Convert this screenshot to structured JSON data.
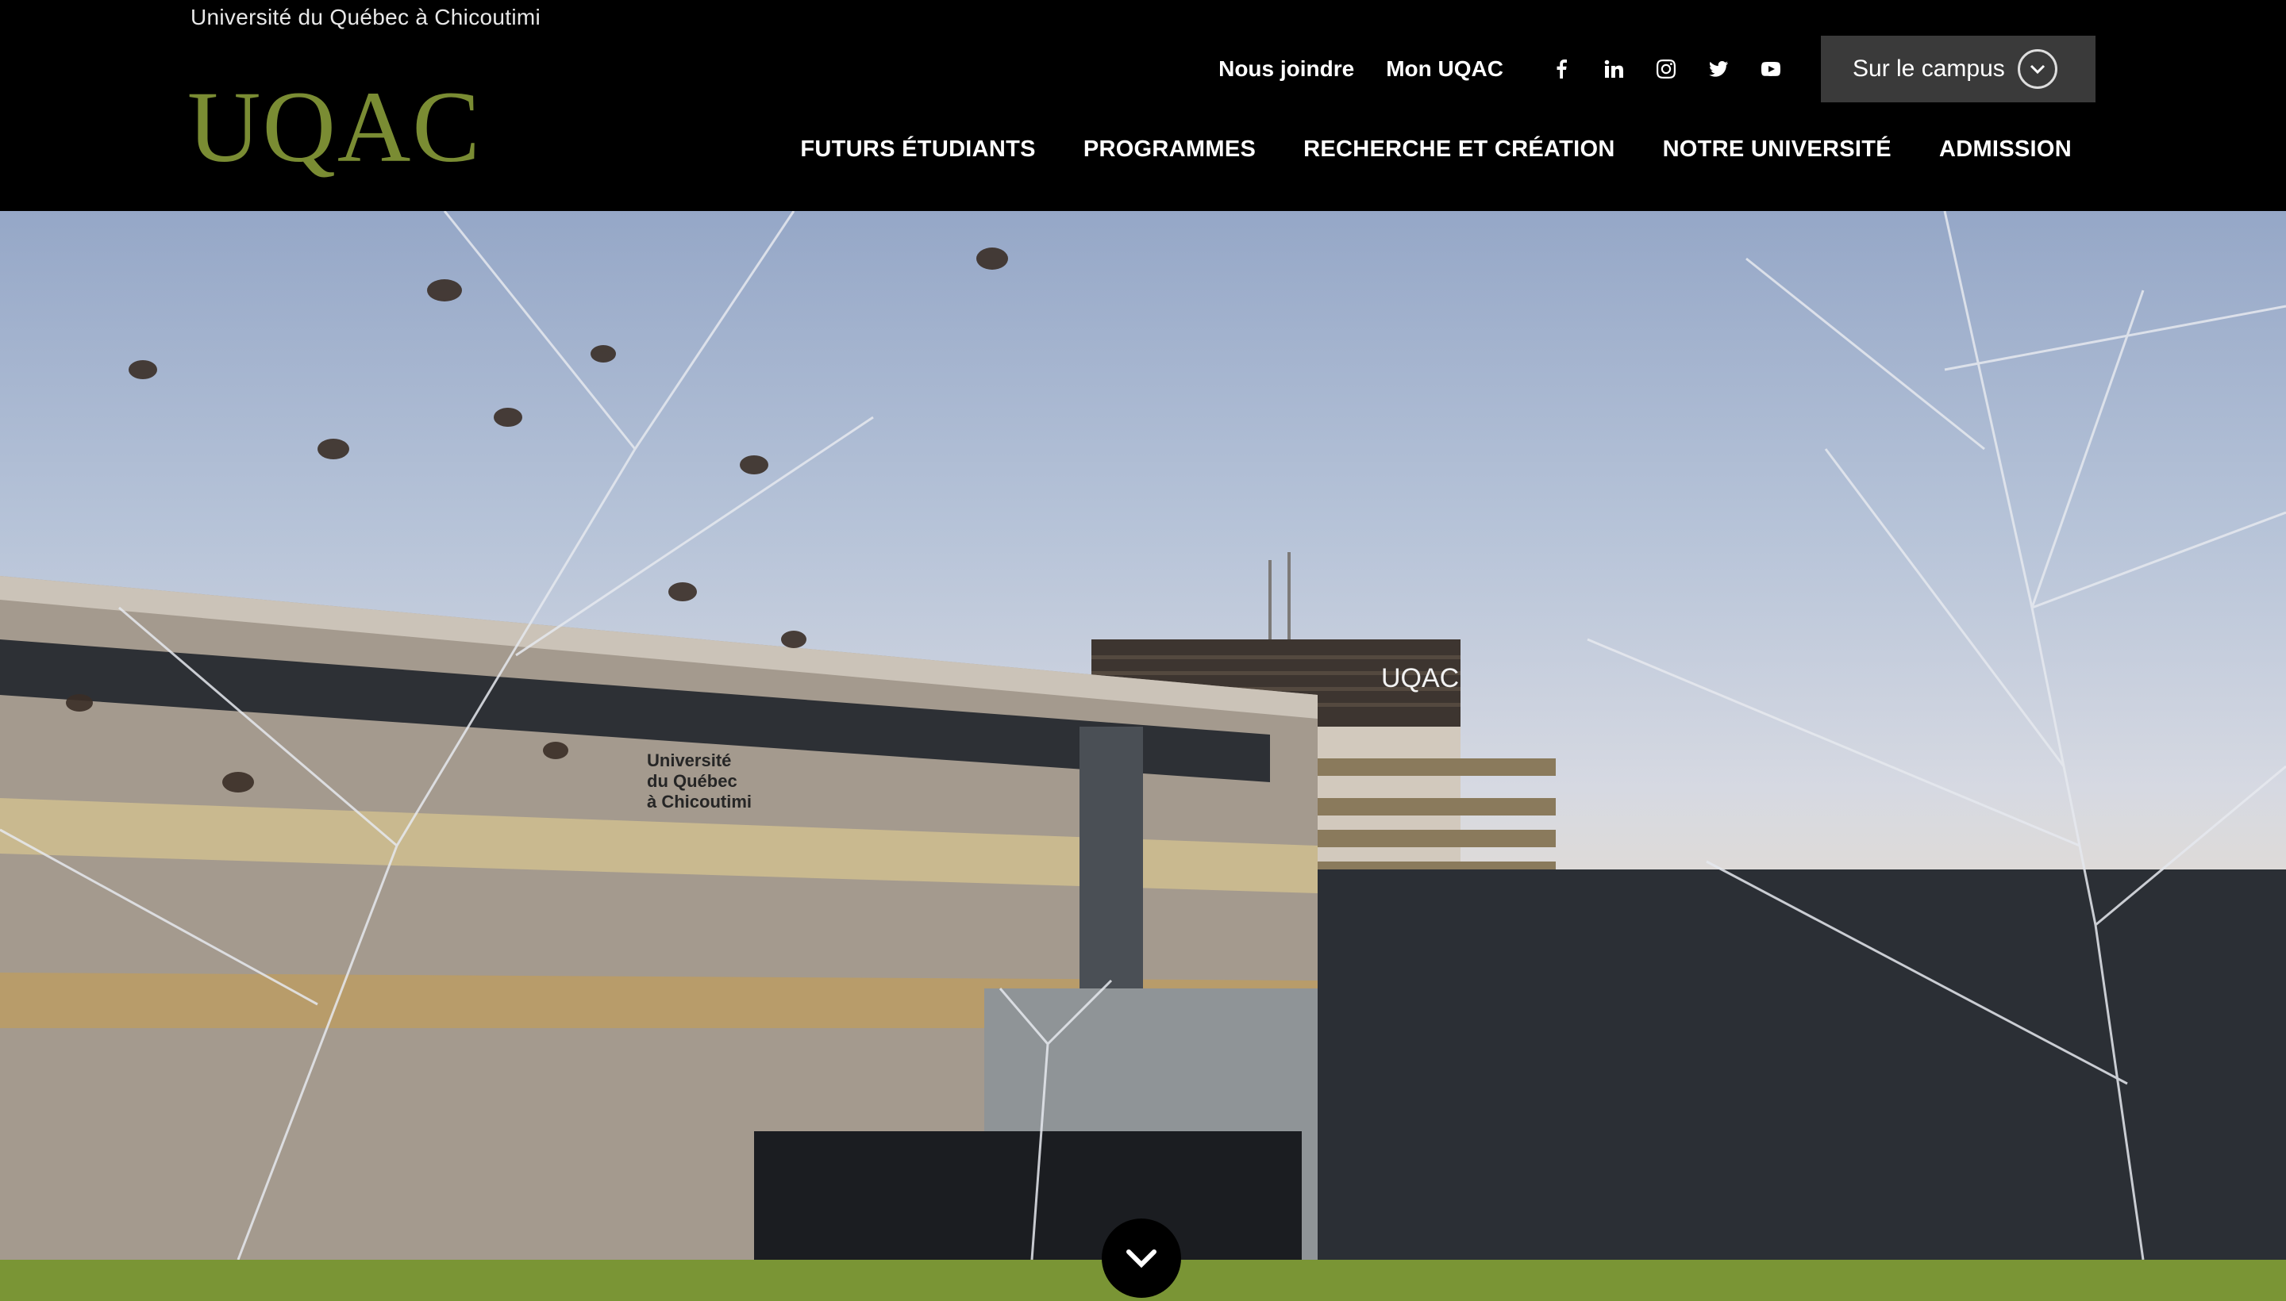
{
  "header": {
    "university_name": "Université du Québec à Chicoutimi",
    "logo_text": "UQAC",
    "logo_color": "#7a8c33",
    "utility_links": [
      "Nous joindre",
      "Mon UQAC"
    ],
    "social_icons": [
      "facebook-icon",
      "linkedin-icon",
      "instagram-icon",
      "twitter-icon",
      "youtube-icon"
    ],
    "campus_button_label": "Sur le campus",
    "main_nav": [
      "FUTURS ÉTUDIANTS",
      "PROGRAMMES",
      "RECHERCHE ET CRÉATION",
      "NOTRE UNIVERSITÉ",
      "ADMISSION"
    ]
  },
  "hero": {
    "building_sign": [
      "Université",
      "du Québec",
      "à Chicoutimi"
    ],
    "tower_sign": "UQAC",
    "accent_bar_color": "#7a9535",
    "scroll_icon": "chevron-down-icon"
  }
}
